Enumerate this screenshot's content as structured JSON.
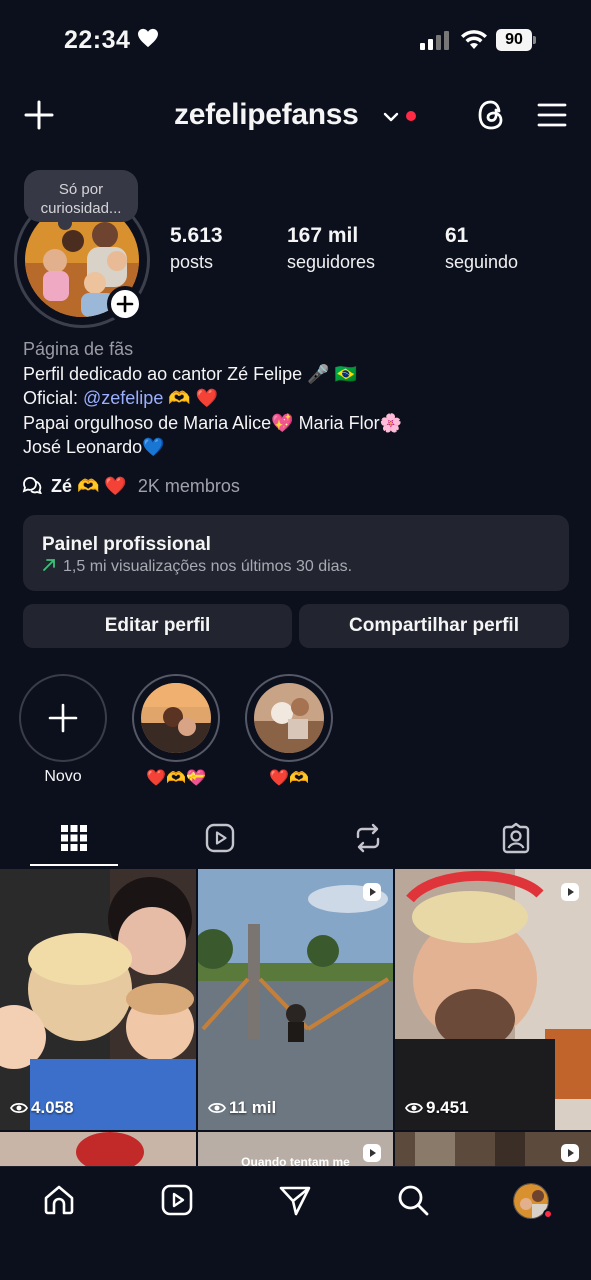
{
  "status_bar": {
    "time": "22:34",
    "battery": "90"
  },
  "header": {
    "username": "zefelipefanss"
  },
  "profile": {
    "note": "Só por curiosidad...",
    "stats": [
      {
        "value": "5.613",
        "label": "posts"
      },
      {
        "value": "167 mil",
        "label": "seguidores"
      },
      {
        "value": "61",
        "label": "seguindo"
      }
    ],
    "category": "Página de fãs",
    "bio": {
      "line1": "Perfil dedicado ao cantor Zé Felipe 🎤 🇧🇷",
      "line2_prefix": "Oficial: ",
      "mention": "@zefelipe",
      "line2_suffix": " 🫶 ❤️",
      "line3": "Papai orgulhoso de Maria Alice💖 Maria Flor🌸",
      "line4": "José Leonardo💙"
    },
    "channel": {
      "name": "Zé 🫶 ❤️",
      "members": "2K membros"
    }
  },
  "panel": {
    "title": "Painel profissional",
    "subtitle": "1,5 mi visualizações nos últimos 30 dias."
  },
  "buttons": {
    "edit": "Editar perfil",
    "share": "Compartilhar perfil"
  },
  "highlights": [
    {
      "label": "Novo"
    },
    {
      "label": "❤️🫶💝"
    },
    {
      "label": "❤️🫶"
    }
  ],
  "grid": [
    {
      "views": "4.058",
      "reel": false
    },
    {
      "views": "11 mil",
      "reel": true
    },
    {
      "views": "9.451",
      "reel": true
    },
    {
      "views": "",
      "reel": false
    },
    {
      "views": "",
      "reel": true,
      "overlay": "Quando tentam me"
    },
    {
      "views": "",
      "reel": true
    }
  ],
  "colors": {
    "background": "#0c0f1c",
    "card": "#22252f",
    "mention": "#9ab0ff",
    "notification": "#ff2b46"
  }
}
